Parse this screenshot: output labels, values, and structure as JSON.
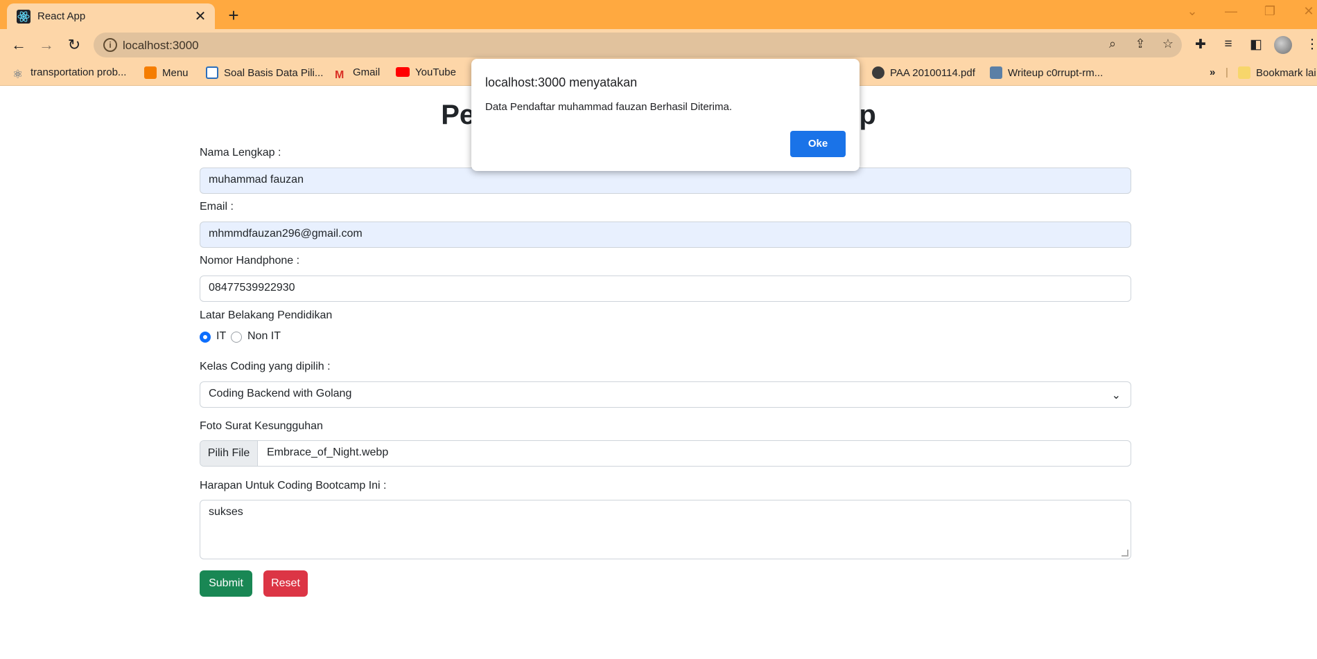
{
  "browser": {
    "tab_title": "React App",
    "new_tab_symbol": "+",
    "url": "localhost:3000",
    "bookmarks": [
      {
        "label": "transportation prob...",
        "icon": "react-icon"
      },
      {
        "label": "Menu",
        "icon": "blogger-icon"
      },
      {
        "label": "Soal Basis Data Pili...",
        "icon": "soal-icon"
      },
      {
        "label": "Gmail",
        "icon": "gmail-icon"
      },
      {
        "label": "YouTube",
        "icon": "youtube-icon"
      },
      {
        "label": "PAA 20100114.pdf",
        "icon": "globe-icon"
      },
      {
        "label": "Writeup c0rrupt-rm...",
        "icon": "writeup-icon"
      }
    ],
    "bookmarks_more": "»",
    "bookmark_other": "Bookmark lai"
  },
  "page": {
    "heading_left": "Pen",
    "heading_right": "amp"
  },
  "form": {
    "name_label": "Nama Lengkap :",
    "name_value": "muhammad fauzan",
    "email_label": "Email :",
    "email_value": "mhmmdfauzan296@gmail.com",
    "phone_label": "Nomor Handphone :",
    "phone_value": "08477539922930",
    "education_label": "Latar Belakang Pendidikan",
    "education_options": [
      {
        "label": "IT",
        "selected": true
      },
      {
        "label": "Non IT",
        "selected": false
      }
    ],
    "class_label": "Kelas Coding yang dipilih :",
    "class_value": "Coding Backend with Golang",
    "photo_label": "Foto Surat Kesungguhan",
    "file_button": "Pilih File",
    "file_name": "Embrace_of_Night.webp",
    "hope_label": "Harapan Untuk Coding Bootcamp Ini :",
    "hope_value": "sukses",
    "submit_label": "Submit",
    "reset_label": "Reset"
  },
  "dialog": {
    "title": "localhost:3000 menyatakan",
    "message": "Data Pendaftar muhammad fauzan Berhasil Diterima.",
    "ok_label": "Oke"
  },
  "colors": {
    "tabstrip": "#ffa940",
    "toolbar": "#fdd6a8",
    "primary": "#0d6efd",
    "success": "#198754",
    "danger": "#dc3545",
    "dialog_button": "#1a73e8"
  }
}
